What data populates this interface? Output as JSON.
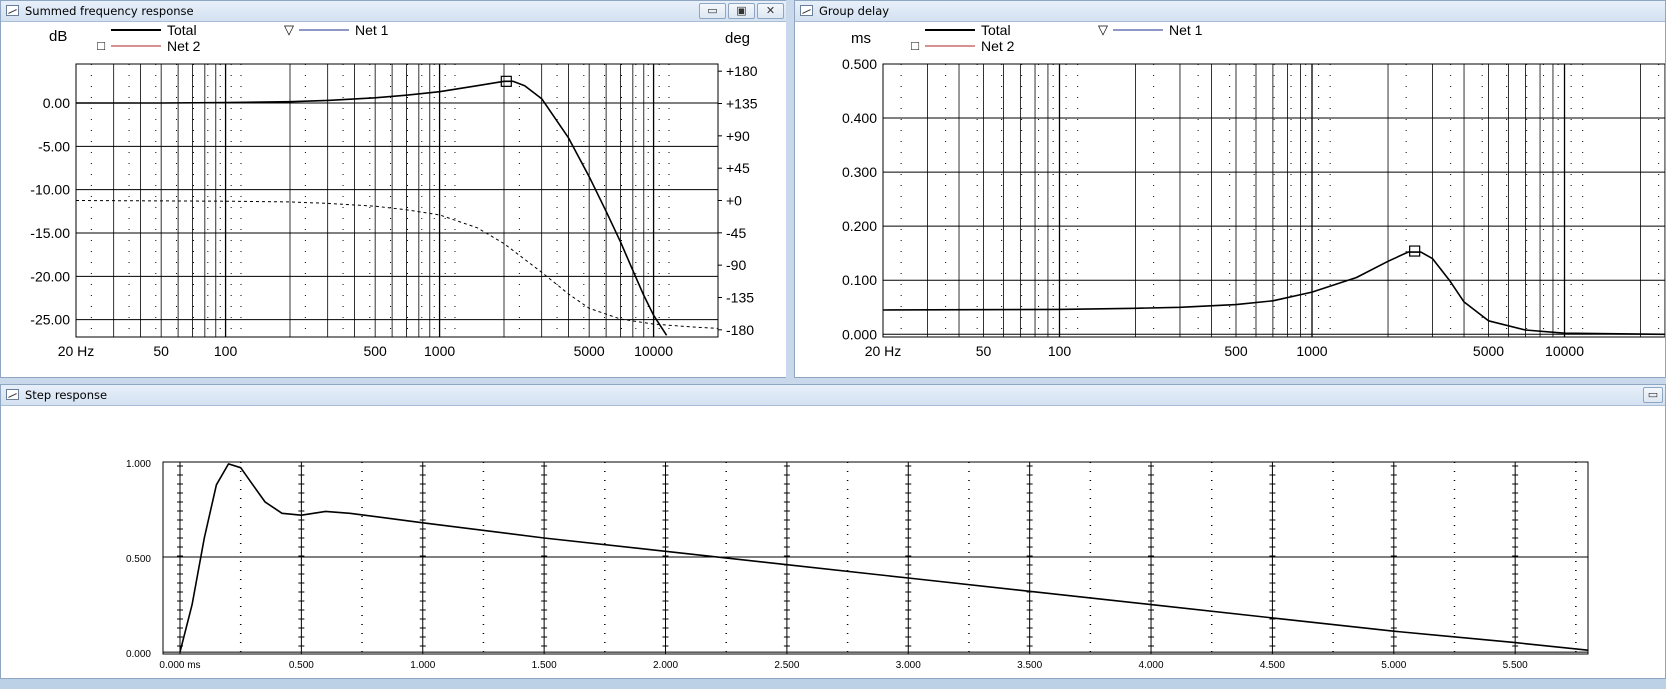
{
  "windows": {
    "freq": {
      "title": "Summed frequency response",
      "buttons": [
        "▭",
        "▣",
        "✕"
      ],
      "left_unit": "dB",
      "right_unit": "deg",
      "legend": [
        {
          "label": "Total",
          "marker": "",
          "color": "#000000"
        },
        {
          "label": "Net 1",
          "marker": "▽",
          "color": "#1f2f8f"
        },
        {
          "label": "Net 2",
          "marker": "□",
          "color": "#b02020"
        }
      ]
    },
    "group": {
      "title": "Group delay",
      "left_unit": "ms",
      "legend": [
        {
          "label": "Total",
          "marker": "",
          "color": "#000000"
        },
        {
          "label": "Net 1",
          "marker": "▽",
          "color": "#1f2f8f"
        },
        {
          "label": "Net 2",
          "marker": "□",
          "color": "#b02020"
        }
      ]
    },
    "step": {
      "title": "Step response",
      "buttons": [
        "▭"
      ]
    }
  },
  "chart_data": [
    {
      "type": "line",
      "name": "freq",
      "xscale": "log",
      "xlim": [
        20,
        20000
      ],
      "xticks": [
        {
          "v": 20,
          "label": "20 Hz"
        },
        {
          "v": 50,
          "label": "50"
        },
        {
          "v": 100,
          "label": "100"
        },
        {
          "v": 500,
          "label": "500"
        },
        {
          "v": 1000,
          "label": "1000"
        },
        {
          "v": 5000,
          "label": "5000"
        },
        {
          "v": 10000,
          "label": "10000"
        }
      ],
      "ylim": [
        -27,
        4.5
      ],
      "yticks": [
        {
          "v": 0,
          "label": "0.00"
        },
        {
          "v": -5,
          "label": "-5.00"
        },
        {
          "v": -10,
          "label": "-10.00"
        },
        {
          "v": -15,
          "label": "-15.00"
        },
        {
          "v": -20,
          "label": "-20.00"
        },
        {
          "v": -25,
          "label": "-25.00"
        }
      ],
      "y2lim": [
        -190,
        190
      ],
      "y2ticks": [
        {
          "v": 180,
          "label": "+180"
        },
        {
          "v": 135,
          "label": "+135"
        },
        {
          "v": 90,
          "label": "+90"
        },
        {
          "v": 45,
          "label": "+45"
        },
        {
          "v": 0,
          "label": "+0"
        },
        {
          "v": -45,
          "label": "-45"
        },
        {
          "v": -90,
          "label": "-90"
        },
        {
          "v": -135,
          "label": "-135"
        },
        {
          "v": -180,
          "label": "-180"
        }
      ],
      "grid": true,
      "series": [
        {
          "role": "magnitude",
          "style": "solid",
          "points": [
            [
              20,
              0
            ],
            [
              50,
              0
            ],
            [
              100,
              0.05
            ],
            [
              200,
              0.15
            ],
            [
              300,
              0.3
            ],
            [
              500,
              0.6
            ],
            [
              700,
              0.9
            ],
            [
              1000,
              1.3
            ],
            [
              1500,
              2.0
            ],
            [
              2000,
              2.5
            ],
            [
              2200,
              2.5
            ],
            [
              2500,
              2.0
            ],
            [
              3000,
              0.5
            ],
            [
              4000,
              -4
            ],
            [
              5000,
              -8.5
            ],
            [
              6000,
              -12.5
            ],
            [
              7000,
              -16
            ],
            [
              8000,
              -19.3
            ],
            [
              9000,
              -22.2
            ],
            [
              10000,
              -24.5
            ],
            [
              11500,
              -26.8
            ]
          ]
        },
        {
          "role": "phase",
          "style": "dashed",
          "axis": "y2",
          "points": [
            [
              20,
              0
            ],
            [
              100,
              -1
            ],
            [
              200,
              -2
            ],
            [
              300,
              -4
            ],
            [
              500,
              -8
            ],
            [
              700,
              -13
            ],
            [
              1000,
              -20
            ],
            [
              1500,
              -38
            ],
            [
              2000,
              -60
            ],
            [
              3000,
              -100
            ],
            [
              4000,
              -130
            ],
            [
              5000,
              -150
            ],
            [
              7000,
              -165
            ],
            [
              10000,
              -172
            ],
            [
              15000,
              -176
            ],
            [
              20000,
              -178
            ]
          ]
        }
      ],
      "marker": {
        "x": 2050,
        "y": 2.5,
        "shape": "square"
      }
    },
    {
      "type": "line",
      "name": "group",
      "xscale": "log",
      "xlim": [
        20,
        25000
      ],
      "xticks": [
        {
          "v": 20,
          "label": "20 Hz"
        },
        {
          "v": 50,
          "label": "50"
        },
        {
          "v": 100,
          "label": "100"
        },
        {
          "v": 500,
          "label": "500"
        },
        {
          "v": 1000,
          "label": "1000"
        },
        {
          "v": 5000,
          "label": "5000"
        },
        {
          "v": 10000,
          "label": "10000"
        }
      ],
      "ylim": [
        -0.005,
        0.5
      ],
      "yticks": [
        {
          "v": 0.5,
          "label": "0.500"
        },
        {
          "v": 0.4,
          "label": "0.400"
        },
        {
          "v": 0.3,
          "label": "0.300"
        },
        {
          "v": 0.2,
          "label": "0.200"
        },
        {
          "v": 0.1,
          "label": "0.100"
        },
        {
          "v": 0,
          "label": "0.000"
        }
      ],
      "grid": true,
      "series": [
        {
          "role": "delay",
          "style": "solid",
          "points": [
            [
              20,
              0.045
            ],
            [
              100,
              0.046
            ],
            [
              200,
              0.048
            ],
            [
              300,
              0.05
            ],
            [
              500,
              0.055
            ],
            [
              700,
              0.062
            ],
            [
              1000,
              0.078
            ],
            [
              1500,
              0.105
            ],
            [
              2000,
              0.135
            ],
            [
              2400,
              0.152
            ],
            [
              2700,
              0.152
            ],
            [
              3000,
              0.14
            ],
            [
              3500,
              0.1
            ],
            [
              4000,
              0.06
            ],
            [
              5000,
              0.025
            ],
            [
              7000,
              0.008
            ],
            [
              10000,
              0.002
            ],
            [
              25000,
              0.0
            ]
          ]
        }
      ],
      "marker": {
        "x": 2550,
        "y": 0.154,
        "shape": "square"
      }
    },
    {
      "type": "line",
      "name": "step",
      "xlim": [
        -0.07,
        5.8
      ],
      "xticks": [
        {
          "v": 0,
          "label": "0.000 ms"
        },
        {
          "v": 0.5,
          "label": "0.500"
        },
        {
          "v": 1,
          "label": "1.000"
        },
        {
          "v": 1.5,
          "label": "1.500"
        },
        {
          "v": 2,
          "label": "2.000"
        },
        {
          "v": 2.5,
          "label": "2.500"
        },
        {
          "v": 3,
          "label": "3.000"
        },
        {
          "v": 3.5,
          "label": "3.500"
        },
        {
          "v": 4,
          "label": "4.000"
        },
        {
          "v": 4.5,
          "label": "4.500"
        },
        {
          "v": 5,
          "label": "5.000"
        },
        {
          "v": 5.5,
          "label": "5.500"
        }
      ],
      "ylim": [
        -0.01,
        1.0
      ],
      "yticks": [
        {
          "v": 1.0,
          "label": "1.000"
        },
        {
          "v": 0.5,
          "label": "0.500"
        },
        {
          "v": 0,
          "label": "0.000"
        }
      ],
      "grid": true,
      "series": [
        {
          "role": "step",
          "style": "solid",
          "points": [
            [
              0,
              0
            ],
            [
              0.05,
              0.25
            ],
            [
              0.1,
              0.6
            ],
            [
              0.15,
              0.88
            ],
            [
              0.2,
              0.99
            ],
            [
              0.25,
              0.97
            ],
            [
              0.3,
              0.88
            ],
            [
              0.35,
              0.79
            ],
            [
              0.42,
              0.73
            ],
            [
              0.5,
              0.72
            ],
            [
              0.6,
              0.74
            ],
            [
              0.7,
              0.73
            ],
            [
              1.0,
              0.68
            ],
            [
              1.5,
              0.6
            ],
            [
              2.0,
              0.53
            ],
            [
              2.5,
              0.46
            ],
            [
              3.0,
              0.39
            ],
            [
              3.5,
              0.32
            ],
            [
              4.0,
              0.25
            ],
            [
              4.5,
              0.18
            ],
            [
              5.0,
              0.11
            ],
            [
              5.5,
              0.05
            ],
            [
              5.8,
              0.01
            ]
          ]
        }
      ]
    }
  ]
}
